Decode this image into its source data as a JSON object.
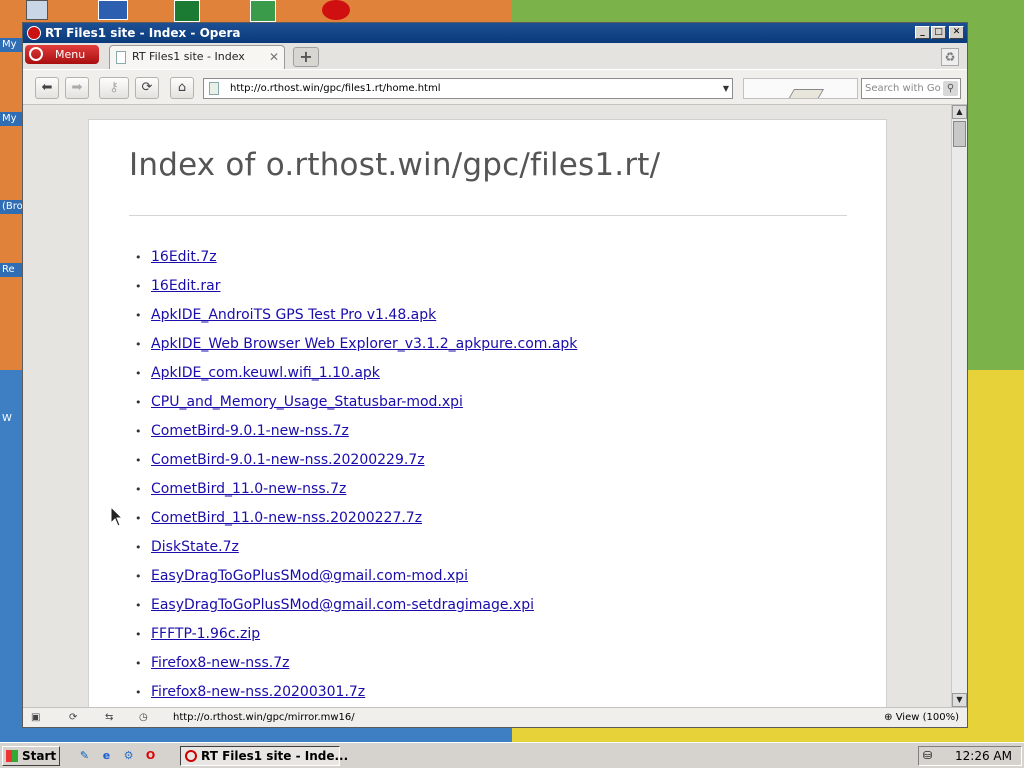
{
  "window": {
    "title": "RT Files1 site - Index - Opera",
    "minimize": "_",
    "maximize": "□",
    "close": "✕"
  },
  "opera_menu": {
    "label": "Menu"
  },
  "tab": {
    "title": "RT Files1 site - Index",
    "close": "✕",
    "new_tab": "+"
  },
  "toolbar": {
    "back": "⬅",
    "forward": "➡",
    "key": "⚷",
    "reload": "⟳",
    "home": "⌂",
    "address": "http://o.rthost.win/gpc/files1.rt/home.html",
    "address_dropdown": "▼",
    "search_placeholder": "Search with Google",
    "search_icon": "⚲"
  },
  "page": {
    "title": "Index of o.rthost.win/gpc/files1.rt/",
    "bullet": "•",
    "files": [
      "16Edit.7z",
      "16Edit.rar",
      "ApkIDE_AndroiTS GPS Test Pro v1.48.apk",
      "ApkIDE_Web Browser Web Explorer_v3.1.2_apkpure.com.apk",
      "ApkIDE_com.keuwl.wifi_1.10.apk",
      "CPU_and_Memory_Usage_Statusbar-mod.xpi",
      "CometBird-9.0.1-new-nss.7z",
      "CometBird-9.0.1-new-nss.20200229.7z",
      "CometBird_11.0-new-nss.7z",
      "CometBird_11.0-new-nss.20200227.7z",
      "DiskState.7z",
      "EasyDragToGoPlusSMod@gmail.com-mod.xpi",
      "EasyDragToGoPlusSMod@gmail.com-setdragimage.xpi",
      "FFFTP-1.96c.zip",
      "Firefox8-new-nss.7z",
      "Firefox8-new-nss.20200301.7z"
    ]
  },
  "scrollbar": {
    "up": "▲",
    "down": "▼"
  },
  "statusbar": {
    "panel_icon": "▣",
    "sync_icon": "⟳",
    "share_icon": "⇆",
    "speed_icon": "◷",
    "url": "http://o.rthost.win/gpc/mirror.mw16/",
    "zoom": "View (100%)",
    "zoom_icon": "⊕"
  },
  "taskbar": {
    "start": "Start",
    "task_label": "RT Files1 site - Inde...",
    "clock": "12:26 AM",
    "quicklaunch": [
      "✎",
      "e",
      "⚙",
      "O"
    ]
  },
  "desktop": {
    "labels": [
      "My",
      "My",
      "(Bro",
      "Re",
      "W"
    ]
  }
}
